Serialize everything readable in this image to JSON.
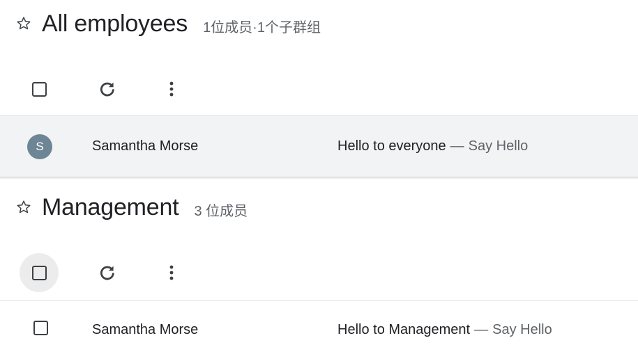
{
  "groups": [
    {
      "title": "All employees",
      "meta": "1位成员·1个子群组",
      "conversations": [
        {
          "avatar_letter": "S",
          "sender": "Samantha Morse",
          "subject": "Hello to everyone",
          "separator": "—",
          "snippet": "Say Hello"
        }
      ]
    },
    {
      "title": "Management",
      "meta": "3 位成员",
      "conversations": [
        {
          "sender": "Samantha Morse",
          "subject": "Hello to Management",
          "separator": "—",
          "snippet": "Say Hello"
        }
      ]
    }
  ],
  "icons": {
    "star": "star-outline-icon",
    "refresh": "refresh-icon",
    "more": "more-vert-icon"
  },
  "colors": {
    "avatar_bg": "#6d8594",
    "selected_row_bg": "#f1f3f4",
    "secondary_text": "#5f6368"
  }
}
